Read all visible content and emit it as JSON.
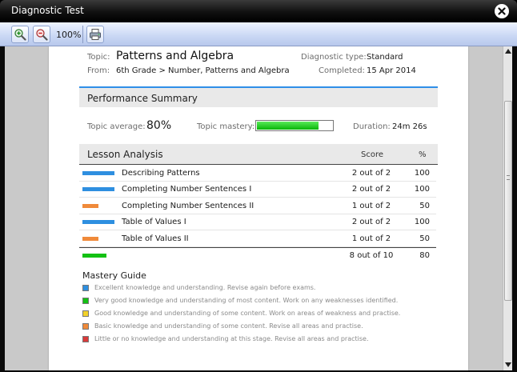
{
  "window": {
    "title": "Diagnostic Test"
  },
  "toolbar": {
    "zoom_label": "100%"
  },
  "header": {
    "topic_label": "Topic:",
    "topic_value": "Patterns and Algebra",
    "from_label": "From:",
    "from_value": "6th Grade > Number, Patterns and Algebra",
    "diagnostic_type_label": "Diagnostic type:",
    "diagnostic_type_value": "Standard",
    "completed_label": "Completed:",
    "completed_value": "15 Apr 2014"
  },
  "performance": {
    "title": "Performance Summary",
    "topic_average_label": "Topic average:",
    "topic_average_value": "80%",
    "topic_mastery_label": "Topic mastery:",
    "topic_mastery_fraction": 0.8,
    "duration_label": "Duration:",
    "duration_value": "24m 26s"
  },
  "lesson_analysis": {
    "title": "Lesson Analysis",
    "col_score": "Score",
    "col_percent": "%",
    "rows": [
      {
        "name": "Describing Patterns",
        "score": "2 out of 2",
        "percent": "100",
        "level": "excellent"
      },
      {
        "name": "Completing Number Sentences I",
        "score": "2 out of 2",
        "percent": "100",
        "level": "excellent"
      },
      {
        "name": "Completing Number Sentences II",
        "score": "1 out of 2",
        "percent": "50",
        "level": "basic"
      },
      {
        "name": "Table of Values I",
        "score": "2 out of 2",
        "percent": "100",
        "level": "excellent"
      },
      {
        "name": "Table of Values II",
        "score": "1 out of 2",
        "percent": "50",
        "level": "basic"
      }
    ],
    "total": {
      "score": "8 out of 10",
      "percent": "80",
      "level": "very-good"
    }
  },
  "mastery_guide": {
    "title": "Mastery Guide",
    "items": [
      {
        "text": "Excellent knowledge and understanding. Revise again before exams.",
        "color": "#2e8fe0"
      },
      {
        "text": "Very good knowledge and understanding of most content. Work on any weaknesses identified.",
        "color": "#13c113"
      },
      {
        "text": "Good knowledge and understanding of some content. Work on areas of weakness and practise.",
        "color": "#f2d22a"
      },
      {
        "text": "Basic knowledge and understanding of some content. Revise all areas and practise.",
        "color": "#f08a3a"
      },
      {
        "text": "Little or no knowledge and understanding at this stage. Revise all areas and practise.",
        "color": "#d93a3a"
      }
    ]
  },
  "colors": {
    "excellent": "#2e8fe0",
    "very-good": "#13c113",
    "basic": "#f08a3a",
    "accent_line": "#2f8fe8"
  },
  "icons": {
    "zoom_in": "zoom-in-icon",
    "zoom_out": "zoom-out-icon",
    "print": "print-icon",
    "close": "close-icon"
  }
}
